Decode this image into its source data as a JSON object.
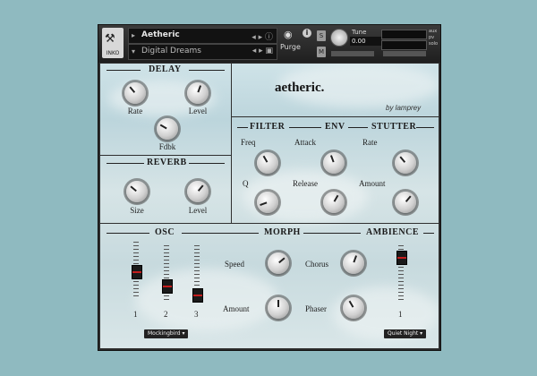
{
  "header": {
    "logo_label": "INKO",
    "instrument_name": "Aetheric",
    "preset_name": "Digital Dreams",
    "purge_label": "Purge",
    "tune_label": "Tune",
    "tune_value": "0.00",
    "side_labels": [
      "aux",
      "pv",
      "solo"
    ]
  },
  "brand": {
    "name": "aetheric.",
    "byline": "by lamprey"
  },
  "delay": {
    "title": "DELAY",
    "rate": "Rate",
    "level": "Level",
    "fdbk": "Fdbk"
  },
  "reverb": {
    "title": "REVERB",
    "size": "Size",
    "level": "Level"
  },
  "filter": {
    "title": "FILTER",
    "freq": "Freq",
    "q": "Q"
  },
  "env": {
    "title": "ENV",
    "attack": "Attack",
    "release": "Release"
  },
  "stutter": {
    "title": "STUTTER",
    "rate": "Rate",
    "amount": "Amount"
  },
  "osc": {
    "title": "OSC",
    "faders": [
      "1",
      "2",
      "3"
    ],
    "menu": "Mockingbird"
  },
  "morph": {
    "title": "MORPH",
    "speed": "Speed",
    "amount": "Amount",
    "chorus": "Chorus",
    "phaser": "Phaser"
  },
  "ambience": {
    "title": "AMBIENCE",
    "fader": "1",
    "menu": "Quiet Night"
  }
}
